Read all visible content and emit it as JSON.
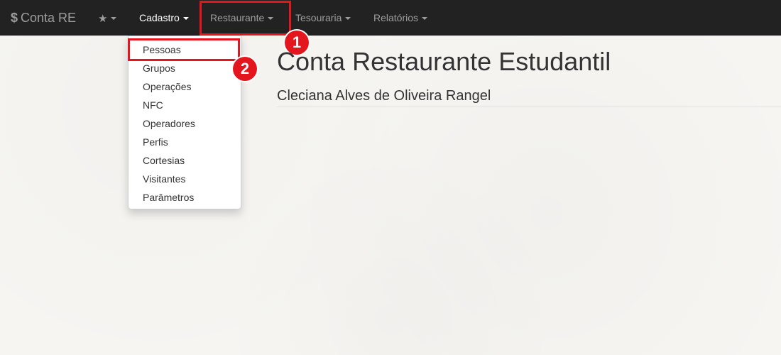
{
  "navbar": {
    "brand_symbol": "$",
    "brand_text": "Conta RE",
    "favorites_icon": "star-icon",
    "items": [
      {
        "label": "Cadastro"
      },
      {
        "label": "Restaurante"
      },
      {
        "label": "Tesouraria"
      },
      {
        "label": "Relatórios"
      }
    ]
  },
  "dropdown": {
    "items": [
      {
        "label": "Pessoas"
      },
      {
        "label": "Grupos"
      },
      {
        "label": "Operações"
      },
      {
        "label": "NFC"
      },
      {
        "label": "Operadores"
      },
      {
        "label": "Perfis"
      },
      {
        "label": "Cortesias"
      },
      {
        "label": "Visitantes"
      },
      {
        "label": "Parâmetros"
      }
    ]
  },
  "main": {
    "title": "Conta Restaurante Estudantil",
    "subtitle": "Cleciana Alves de Oliveira Rangel"
  },
  "annotations": {
    "step1": "1",
    "step2": "2"
  },
  "colors": {
    "navbar_bg": "#222222",
    "highlight": "#e3161d"
  }
}
